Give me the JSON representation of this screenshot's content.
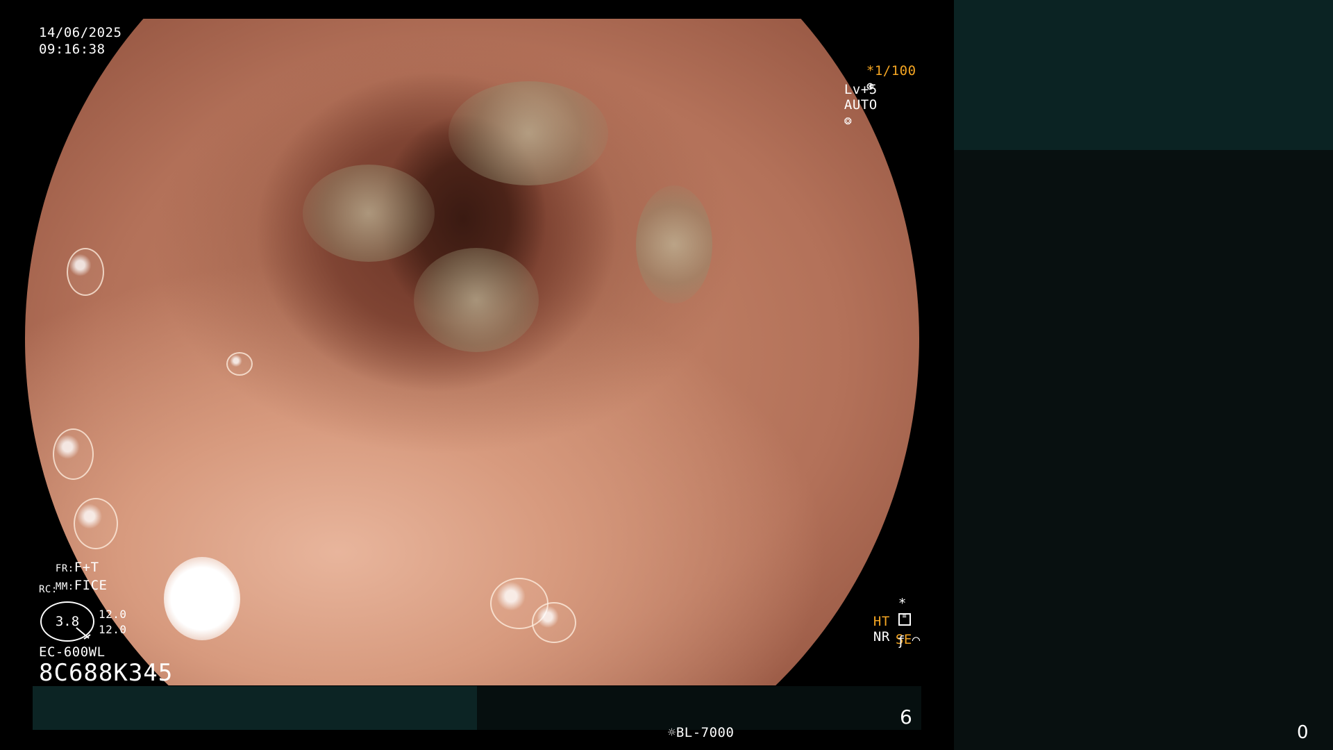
{
  "datetime": {
    "date": "14/06/2025",
    "time": "09:16:38"
  },
  "top_right": {
    "shutter": "*1/100",
    "shutter_icon": "aperture-icon",
    "level": "Lv+5",
    "auto_mode": "AUTO",
    "auto_icon": "iris-icon"
  },
  "bottom_left": {
    "fr_label": "FR:",
    "fr_value": "F+T",
    "mm_label": "MM:",
    "mm_value": "FICE",
    "rc_label": "RC:",
    "zoom_value": "3.8",
    "param_1": "12.0",
    "param_2": "12.0",
    "scope_model": "EC-600WL",
    "serial": "8C688K345"
  },
  "bottom_right": {
    "star": "*",
    "settings_icon": "list-settings-icon",
    "ht_label": "HT",
    "nr_label": "NR",
    "se_label": "SE",
    "se_icon": "curve-icon",
    "freeze_icon": "strike-f-icon"
  },
  "status_bar": {
    "light_icon": "lamp-icon",
    "light_source": "BL-7000",
    "image_count": "6"
  },
  "side_panel": {
    "counter": "0"
  },
  "colors": {
    "accent_orange": "#f5a623",
    "panel_dark_teal": "#0b2323",
    "panel_black": "#081010"
  }
}
